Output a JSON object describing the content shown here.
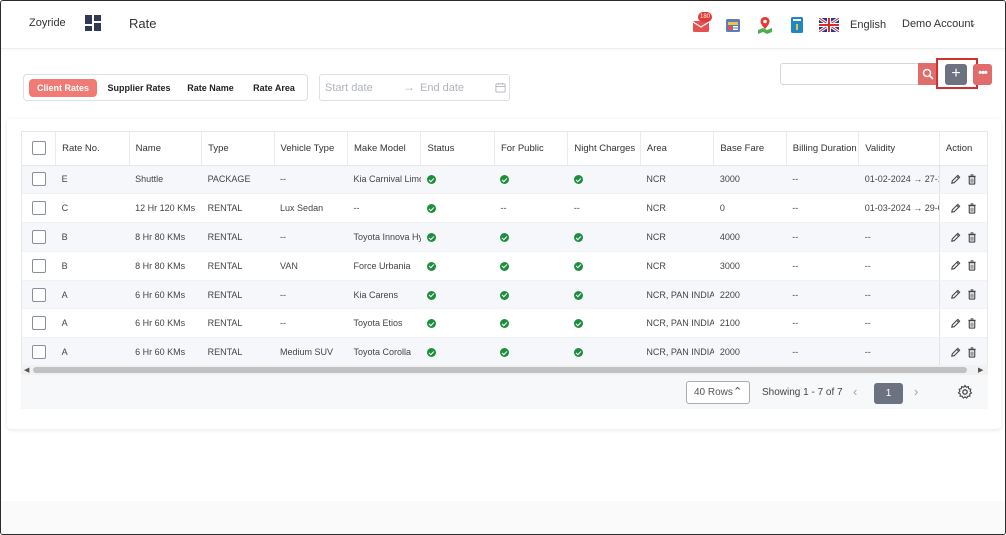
{
  "header": {
    "brand": "Zoyride",
    "page_title": "Rate",
    "notification_count": "180",
    "language": "English",
    "account": "Demo Account"
  },
  "toolbar": {
    "tabs": [
      {
        "label": "Client Rates",
        "active": true
      },
      {
        "label": "Supplier Rates",
        "active": false
      },
      {
        "label": "Rate Name",
        "active": false
      },
      {
        "label": "Rate Area",
        "active": false
      }
    ],
    "start_date_placeholder": "Start date",
    "end_date_placeholder": "End date",
    "search_value": ""
  },
  "table": {
    "columns": [
      "Rate No.",
      "Name",
      "Type",
      "Vehicle Type",
      "Make Model",
      "Status",
      "For Public",
      "Night Charges",
      "Area",
      "Base Fare",
      "Billing Duration",
      "Validity",
      "Action"
    ],
    "rows": [
      {
        "rate_no": "E",
        "name": "Shuttle",
        "type": "PACKAGE",
        "vehicle_type": "--",
        "make_model": "Kia Carnival Limo",
        "status": true,
        "for_public": true,
        "night_charges": true,
        "area": "NCR",
        "base_fare": "3000",
        "billing_duration": "--",
        "validity": "01-02-2024 → 27-1"
      },
      {
        "rate_no": "C",
        "name": "12 Hr 120 KMs",
        "type": "RENTAL",
        "vehicle_type": "Lux Sedan",
        "make_model": "--",
        "status": true,
        "for_public": false,
        "night_charges": false,
        "area": "NCR",
        "base_fare": "0",
        "billing_duration": "--",
        "validity": "01-03-2024 → 29-0"
      },
      {
        "rate_no": "B",
        "name": "8 Hr 80 KMs",
        "type": "RENTAL",
        "vehicle_type": "--",
        "make_model": "Toyota Innova Hy",
        "status": true,
        "for_public": true,
        "night_charges": true,
        "area": "NCR",
        "base_fare": "4000",
        "billing_duration": "--",
        "validity": "--"
      },
      {
        "rate_no": "B",
        "name": "8 Hr 80 KMs",
        "type": "RENTAL",
        "vehicle_type": "VAN",
        "make_model": "Force Urbania",
        "status": true,
        "for_public": true,
        "night_charges": true,
        "area": "NCR",
        "base_fare": "3000",
        "billing_duration": "--",
        "validity": "--"
      },
      {
        "rate_no": "A",
        "name": "6 Hr 60 KMs",
        "type": "RENTAL",
        "vehicle_type": "--",
        "make_model": "Kia Carens",
        "status": true,
        "for_public": true,
        "night_charges": true,
        "area": "NCR, PAN INDIA",
        "base_fare": "2200",
        "billing_duration": "--",
        "validity": "--"
      },
      {
        "rate_no": "A",
        "name": "6 Hr 60 KMs",
        "type": "RENTAL",
        "vehicle_type": "--",
        "make_model": "Toyota Etios",
        "status": true,
        "for_public": true,
        "night_charges": true,
        "area": "NCR, PAN INDIA",
        "base_fare": "2100",
        "billing_duration": "--",
        "validity": "--"
      },
      {
        "rate_no": "A",
        "name": "6 Hr 60 KMs",
        "type": "RENTAL",
        "vehicle_type": "Medium SUV",
        "make_model": "Toyota Corolla",
        "status": true,
        "for_public": true,
        "night_charges": true,
        "area": "NCR, PAN INDIA",
        "base_fare": "2000",
        "billing_duration": "--",
        "validity": "--"
      }
    ]
  },
  "pagination": {
    "rows_per_page": "40 Rows",
    "showing": "Showing  1 - 7 of 7",
    "current_page": "1"
  },
  "colors": {
    "accent": "#ef7b74",
    "search_button": "#e06c6b",
    "add_button": "#6b7280",
    "check_green": "#1e8e3e",
    "highlight": "#d32f2f"
  },
  "icons": {
    "mail": "mail-icon",
    "id_card": "id-card-icon",
    "map_pin": "map-pin-icon",
    "book": "book-icon",
    "flag": "uk-flag-icon",
    "edit": "pencil-icon",
    "delete": "trash-icon",
    "settings": "gear-icon"
  }
}
